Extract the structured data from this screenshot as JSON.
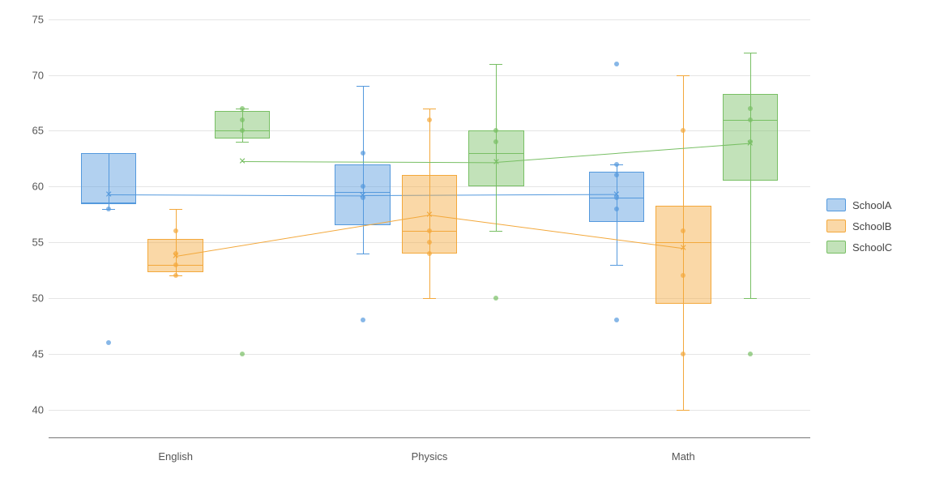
{
  "chart_data": {
    "type": "boxplot",
    "categories": [
      "English",
      "Physics",
      "Math"
    ],
    "ylim": [
      37.5,
      76
    ],
    "y_ticks": [
      40,
      45,
      50,
      55,
      60,
      65,
      70,
      75
    ],
    "series": [
      {
        "name": "SchoolA",
        "color_fill": "rgba(84,153,221,0.45)",
        "color_stroke": "#5499dd",
        "boxes": [
          {
            "min": 58,
            "q1": 58.5,
            "median": 58.5,
            "q3": 63,
            "max": 63,
            "mean": 59.3,
            "outliers": [
              46
            ],
            "points": [
              58
            ]
          },
          {
            "min": 54,
            "q1": 56.5,
            "median": 59.5,
            "q3": 62,
            "max": 69,
            "mean": 59.2,
            "outliers": [
              48
            ],
            "points": [
              59,
              60,
              63
            ]
          },
          {
            "min": 53,
            "q1": 56.8,
            "median": 59,
            "q3": 61.3,
            "max": 62,
            "mean": 59.3,
            "outliers": [
              71,
              48
            ],
            "points": [
              58,
              59,
              61,
              62
            ]
          }
        ]
      },
      {
        "name": "SchoolB",
        "color_fill": "rgba(243,168,59,0.45)",
        "color_stroke": "#f3a83b",
        "boxes": [
          {
            "min": 52,
            "q1": 52.3,
            "median": 53,
            "q3": 55.3,
            "max": 58,
            "mean": 53.8,
            "outliers": [],
            "points": [
              52,
              53,
              56,
              54
            ]
          },
          {
            "min": 50,
            "q1": 54,
            "median": 56,
            "q3": 61,
            "max": 67,
            "mean": 57.5,
            "outliers": [],
            "points": [
              54,
              55,
              56,
              66
            ]
          },
          {
            "min": 40,
            "q1": 49.5,
            "median": 55,
            "q3": 58.3,
            "max": 70,
            "mean": 54.5,
            "outliers": [],
            "points": [
              45,
              52,
              56,
              65
            ]
          }
        ]
      },
      {
        "name": "SchoolC",
        "color_fill": "rgba(120,191,100,0.45)",
        "color_stroke": "#78bf64",
        "boxes": [
          {
            "min": 64,
            "q1": 64.3,
            "median": 65,
            "q3": 66.8,
            "max": 67,
            "mean": 62.3,
            "outliers": [
              45
            ],
            "points": [
              65,
              66,
              67
            ]
          },
          {
            "min": 56,
            "q1": 60,
            "median": 63,
            "q3": 65,
            "max": 71,
            "mean": 62.2,
            "outliers": [
              50
            ],
            "points": [
              64,
              65
            ]
          },
          {
            "min": 50,
            "q1": 60.5,
            "median": 66,
            "q3": 68.3,
            "max": 72,
            "mean": 63.9,
            "outliers": [
              45
            ],
            "points": [
              64,
              66,
              67
            ]
          }
        ]
      }
    ],
    "legend_position": "right"
  }
}
